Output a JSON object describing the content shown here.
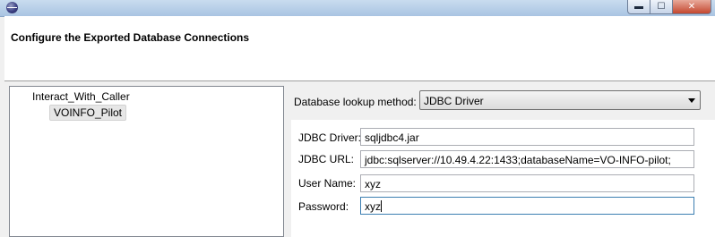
{
  "window": {
    "min_glyph": "▬",
    "max_glyph": "☐",
    "close_glyph": "✕"
  },
  "header": {
    "title": "Configure the Exported Database Connections"
  },
  "tree": {
    "root": "Interact_With_Caller",
    "child": "VOINFO_Pilot"
  },
  "lookup": {
    "label": "Database lookup method:",
    "value": "JDBC Driver"
  },
  "form": {
    "driver": {
      "label": "JDBC Driver:",
      "value": "sqljdbc4.jar"
    },
    "url": {
      "label": "JDBC URL:",
      "value": "jdbc:sqlserver://10.49.4.22:1433;databaseName=VO-INFO-pilot;"
    },
    "user": {
      "label": "User Name:",
      "value": "xyz"
    },
    "password": {
      "label": "Password:",
      "value": "xyz"
    }
  }
}
